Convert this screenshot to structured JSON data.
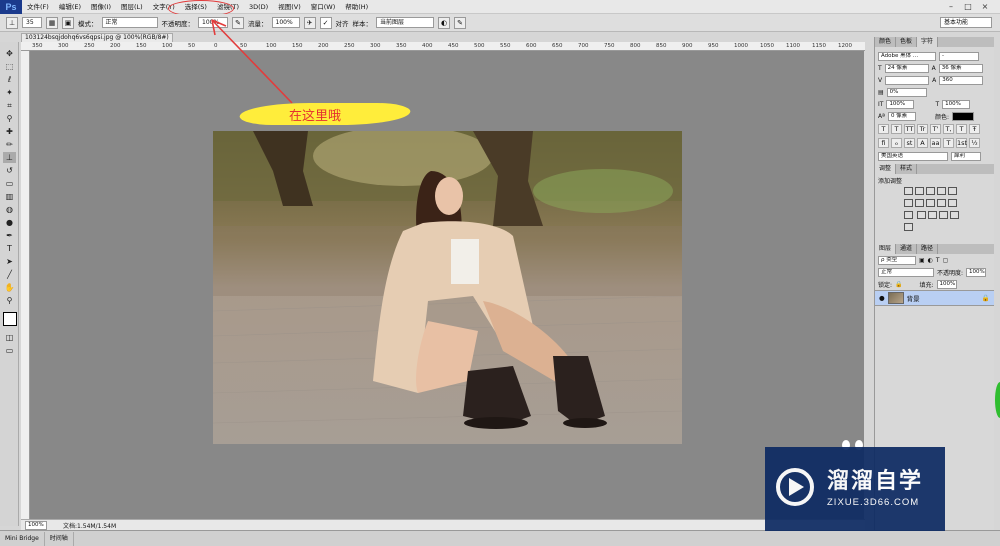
{
  "app": {
    "logo": "Ps",
    "workspace": "基本功能"
  },
  "menu": [
    "文件(F)",
    "编辑(E)",
    "图像(I)",
    "图层(L)",
    "文字(Y)",
    "选择(S)",
    "滤镜(T)",
    "3D(D)",
    "视图(V)",
    "窗口(W)",
    "帮助(H)"
  ],
  "window_controls": [
    "–",
    "□",
    "×"
  ],
  "options": {
    "brush_size": "35",
    "mode_label": "模式：",
    "mode_value": "正常",
    "opacity_label": "不透明度：",
    "opacity_value": "100%",
    "flow_label": "流量：",
    "flow_value": "100%",
    "aligned_label": "对齐",
    "sample_label": "样本：",
    "sample_value": "当前图层"
  },
  "document": {
    "tab_title": "103124bsqjdohq6vs6qpsi.jpg @ 100%(RGB/8#)",
    "tab_close": "×",
    "ruler_ticks": [
      "350",
      "300",
      "250",
      "200",
      "150",
      "100",
      "50",
      "0",
      "50",
      "100",
      "150",
      "200",
      "250",
      "300",
      "350",
      "400",
      "450",
      "500",
      "550",
      "600",
      "650",
      "700",
      "750",
      "800",
      "850",
      "900",
      "950",
      "1000",
      "1050",
      "1100",
      "1150",
      "1200"
    ]
  },
  "status": {
    "zoom": "100%",
    "doc_info": "文档:1.54M/1.54M"
  },
  "bottom_tabs": [
    "Mini Bridge",
    "时间轴"
  ],
  "annotation": {
    "text": "在这里哦",
    "arrow_color": "#e23c3c",
    "highlight_color": "#ffed3b"
  },
  "char_panel": {
    "tabs": [
      "颜色",
      "色板",
      "字符"
    ],
    "font_family": "Adobe 黑体 ...",
    "font_style": "-",
    "font_size": "24 像素",
    "leading": "36 像素",
    "kerning": "",
    "tracking": "360",
    "scale_pct": "0%",
    "vscale": "100%",
    "hscale": "100%",
    "baseline": "0 像素",
    "color_label": "颜色:",
    "glyphs": [
      "T",
      "T",
      "TT",
      "Tr",
      "T'",
      "T,",
      "T",
      "Ŧ"
    ],
    "glyphs2": [
      "fi",
      "ℴ",
      "st",
      "A",
      "aa",
      "T",
      "1st",
      "½"
    ],
    "language": "美国英语",
    "antialias": "犀利"
  },
  "adjust_panel": {
    "tabs": [
      "调整",
      "样式"
    ],
    "title": "添加调整"
  },
  "layers_panel": {
    "tabs": [
      "图层",
      "通道",
      "路径"
    ],
    "filter_label": "ρ 类型",
    "blend_mode": "正常",
    "opacity_label": "不透明度:",
    "opacity_value": "100%",
    "lock_label": "锁定:",
    "fill_label": "填充:",
    "fill_value": "100%",
    "layer_name": "背景"
  },
  "watermark": {
    "title": "溜溜自学",
    "subtitle": "ZIXUE.3D66.COM"
  }
}
